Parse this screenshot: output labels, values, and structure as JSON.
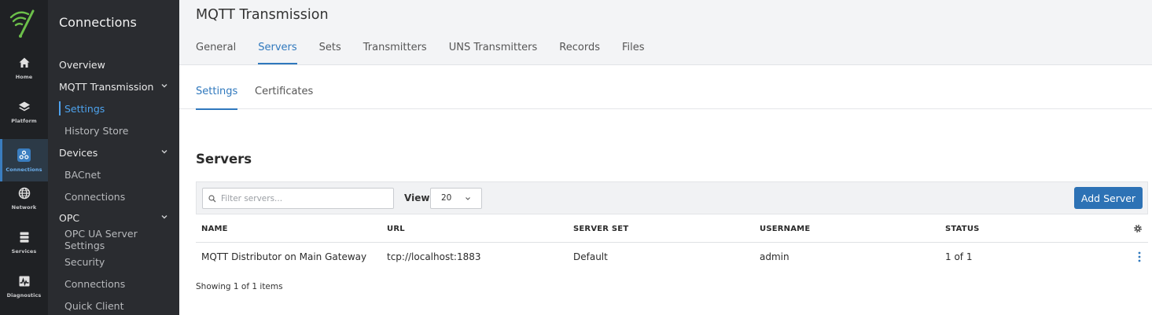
{
  "rail": {
    "items": [
      {
        "label": "Home",
        "icon": "home-icon"
      },
      {
        "label": "Platform",
        "icon": "layers-icon"
      },
      {
        "label": "Connections",
        "icon": "connections-icon",
        "active": true
      },
      {
        "label": "Network",
        "icon": "globe-icon"
      },
      {
        "label": "Services",
        "icon": "server-icon"
      },
      {
        "label": "Diagnostics",
        "icon": "pulse-icon"
      }
    ]
  },
  "subnav": {
    "title": "Connections",
    "items": [
      {
        "label": "Overview",
        "level": 1
      },
      {
        "label": "MQTT Transmission",
        "level": 1,
        "expanded": true
      },
      {
        "label": "Settings",
        "level": 2,
        "active": true
      },
      {
        "label": "History Store",
        "level": 2
      },
      {
        "label": "Devices",
        "level": 1,
        "expanded": true
      },
      {
        "label": "BACnet",
        "level": 2
      },
      {
        "label": "Connections",
        "level": 2
      },
      {
        "label": "OPC",
        "level": 1,
        "expanded": true
      },
      {
        "label": "OPC UA Server Settings",
        "level": 2
      },
      {
        "label": "Security",
        "level": 2
      },
      {
        "label": "Connections",
        "level": 2
      },
      {
        "label": "Quick Client",
        "level": 2
      }
    ]
  },
  "header": {
    "title": "MQTT Transmission",
    "tabs": [
      "General",
      "Servers",
      "Sets",
      "Transmitters",
      "UNS Transmitters",
      "Records",
      "Files"
    ],
    "active_tab": "Servers"
  },
  "subtabs": {
    "items": [
      "Settings",
      "Certificates"
    ],
    "active": "Settings"
  },
  "servers": {
    "title": "Servers",
    "filter_placeholder": "Filter servers...",
    "view_label": "View",
    "view_value": "20",
    "add_button": "Add Server",
    "columns": [
      "NAME",
      "URL",
      "SERVER SET",
      "USERNAME",
      "STATUS"
    ],
    "rows": [
      {
        "name": "MQTT Distributor on Main Gateway",
        "url": "tcp://localhost:1883",
        "server_set": "Default",
        "username": "admin",
        "status": "1 of 1"
      }
    ],
    "showing": "Showing 1 of 1 items"
  },
  "colors": {
    "accent": "#2f78bd",
    "rail_bg": "#1f2124",
    "subnav_bg": "#2a2c30",
    "logo_green": "#6cc04a"
  }
}
